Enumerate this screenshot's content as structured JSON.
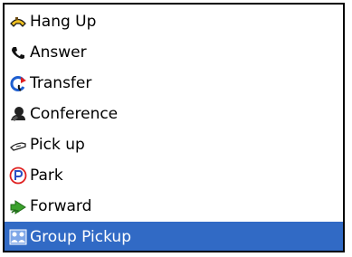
{
  "menu": {
    "items": [
      {
        "label": "Hang Up",
        "icon": "hang-up-icon"
      },
      {
        "label": "Answer",
        "icon": "answer-icon"
      },
      {
        "label": "Transfer",
        "icon": "transfer-icon"
      },
      {
        "label": "Conference",
        "icon": "conference-icon"
      },
      {
        "label": "Pick up",
        "icon": "pick-up-icon"
      },
      {
        "label": "Park",
        "icon": "park-icon"
      },
      {
        "label": "Forward",
        "icon": "forward-icon"
      },
      {
        "label": "Group Pickup",
        "icon": "group-pickup-icon",
        "selected": true
      }
    ]
  },
  "colors": {
    "selection": "#316ac5",
    "border": "#000000",
    "park_red": "#e02020",
    "forward_green": "#3aa12c",
    "hangup_yellow": "#f0c020",
    "transfer_blue": "#1f5fd0"
  }
}
